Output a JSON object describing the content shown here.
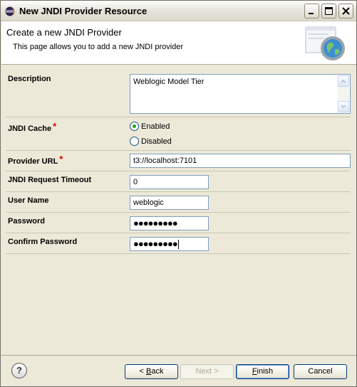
{
  "window": {
    "title": "New JNDI Provider Resource"
  },
  "header": {
    "title": "Create a new JNDI Provider",
    "description": "This page allows you to add a new JNDI provider"
  },
  "form": {
    "description": {
      "label": "Description",
      "value": "Weblogic Model Tier"
    },
    "jndi_cache": {
      "label": "JNDI Cache",
      "required": "*",
      "options": [
        "Enabled",
        "Disabled"
      ],
      "selected": "Enabled"
    },
    "provider_url": {
      "label": "Provider URL",
      "required": "*",
      "value": "t3://localhost:7101"
    },
    "request_timeout": {
      "label": "JNDI Request Timeout",
      "value": "0"
    },
    "user_name": {
      "label": "User Name",
      "value": "weblogic"
    },
    "password": {
      "label": "Password",
      "masked": "●●●●●●●●●"
    },
    "confirm_password": {
      "label": "Confirm Password",
      "masked": "●●●●●●●●●"
    }
  },
  "buttons": {
    "help": "?",
    "back_prefix": "< ",
    "back_mnemonic": "B",
    "back_rest": "ack",
    "next": "Next >",
    "finish_mnemonic": "F",
    "finish_rest": "inish",
    "cancel": "Cancel"
  },
  "colors": {
    "required": "#e00000",
    "radio_selected": "#21a121",
    "input_border": "#7f9db9"
  }
}
